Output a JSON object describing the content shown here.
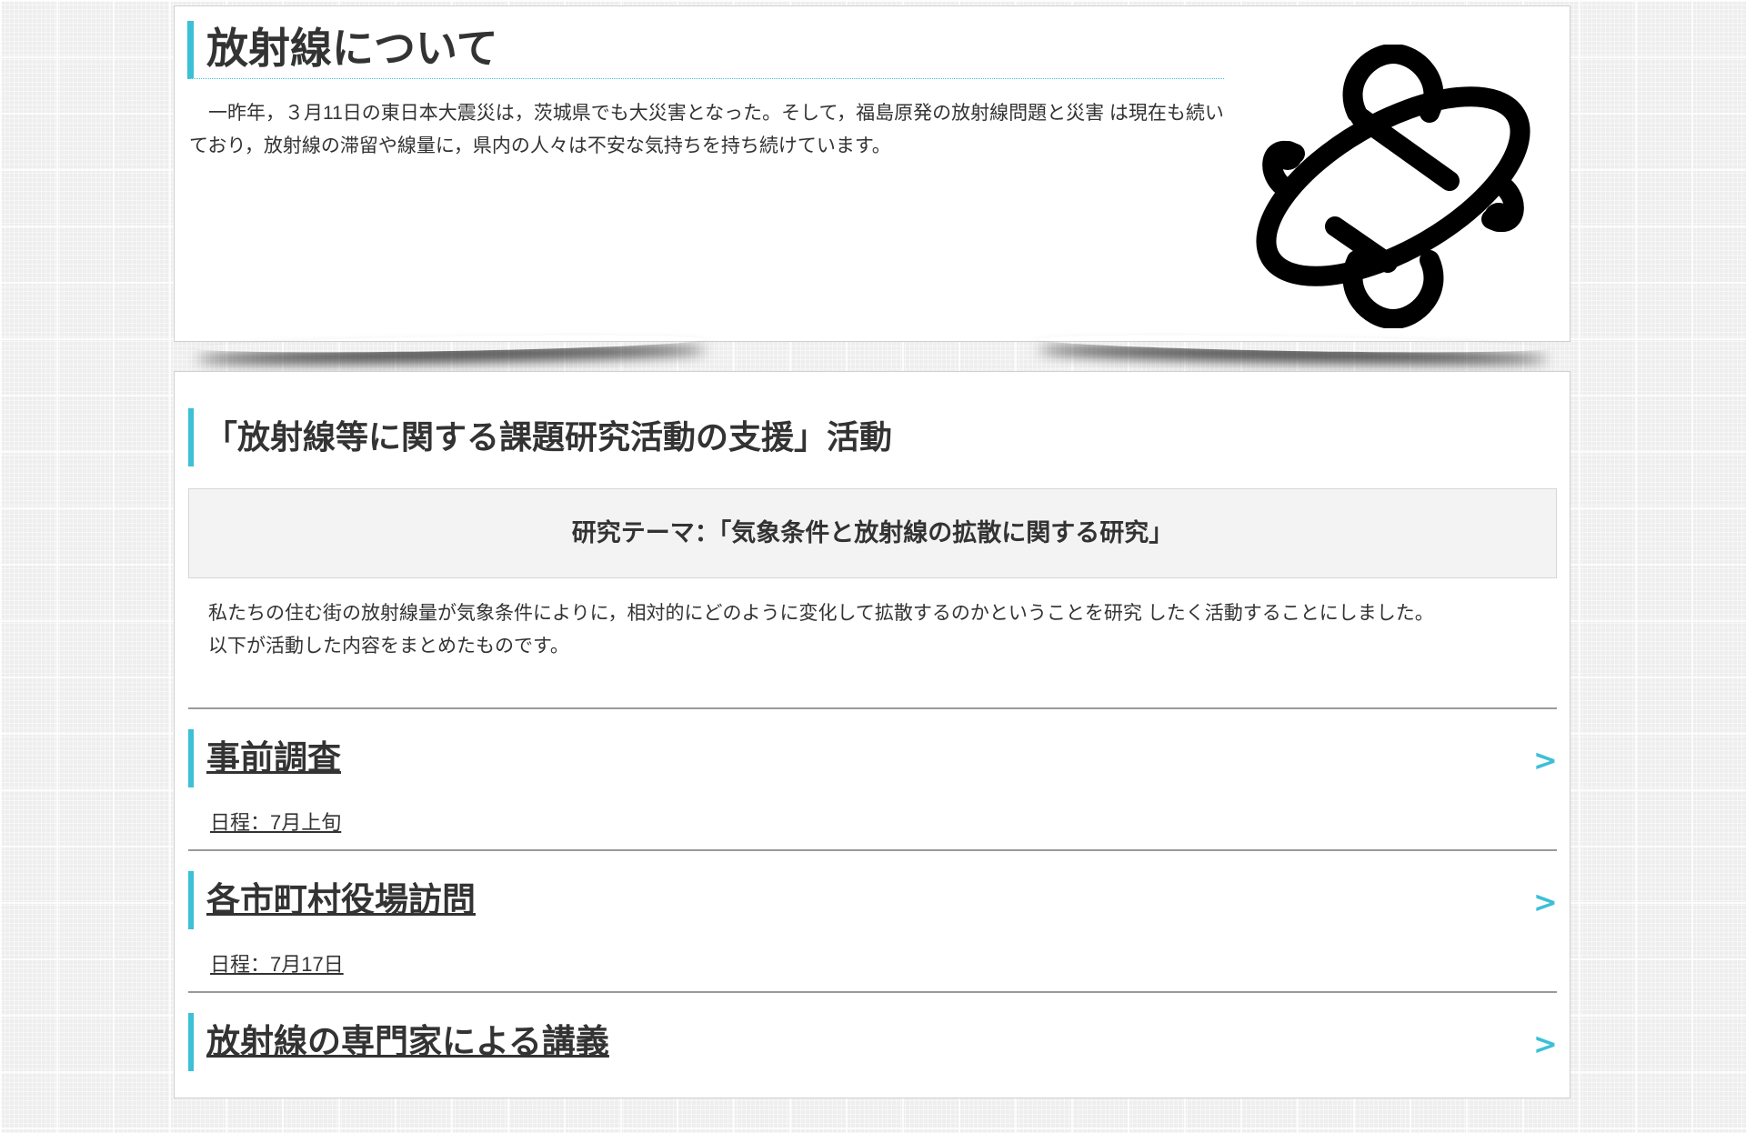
{
  "intro_section": {
    "title": "放射線について",
    "text": "一昨年，３月11日の東日本大震災は，茨城県でも大災害となった。そして，福島原発の放射線問題と災害 は現在も続いており，放射線の滞留や線量に，県内の人々は不安な気持ちを持ち続けています。",
    "logo_icon": "atom-icon"
  },
  "activity_section": {
    "heading": "「放射線等に関する課題研究活動の支援」活動",
    "theme": "研究テーマ：「気象条件と放射線の拡散に関する研究」",
    "paragraphs": [
      "私たちの住む街の放射線量が気象条件によりに，相対的にどのように変化して拡散するのかということを研究 したく活動することにしました。",
      "以下が活動した内容をまとめたものです。"
    ],
    "items": [
      {
        "title": "事前調査",
        "date": "日程：7月上旬",
        "arrow": ">"
      },
      {
        "title": "各市町村役場訪問",
        "date": "日程：7月17日",
        "arrow": ">"
      },
      {
        "title": "放射線の専門家による講義",
        "date": "",
        "arrow": ">"
      }
    ]
  },
  "colors": {
    "accent": "#3cc0d6",
    "text": "#333333",
    "panel": "#ffffff",
    "theme_box": "#f3f3f3",
    "background": "#eeeeee"
  }
}
